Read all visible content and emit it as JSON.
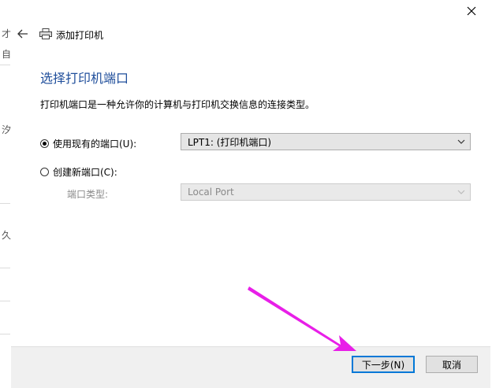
{
  "background_window": {
    "glyphs": [
      "才",
      "自",
      "汐",
      "久"
    ]
  },
  "dialog": {
    "title": "添加打印机",
    "heading": "选择打印机端口",
    "description": "打印机端口是一种允许你的计算机与打印机交换信息的连接类型。",
    "existing_port": {
      "label": "使用现有的端口(U):",
      "selected": true,
      "value": "LPT1: (打印机端口)"
    },
    "new_port": {
      "label": "创建新端口(C):",
      "selected": false,
      "type_label": "端口类型:",
      "type_value": "Local Port"
    },
    "buttons": {
      "next": "下一步(N)",
      "cancel": "取消"
    }
  },
  "colors": {
    "heading": "#1f4e9b",
    "primary_border": "#0078d7",
    "annotation_arrow": "#e81fe8"
  },
  "icons": [
    "close-icon",
    "back-arrow-icon",
    "printer-icon",
    "chevron-down-icon",
    "annotation-arrow-icon"
  ]
}
